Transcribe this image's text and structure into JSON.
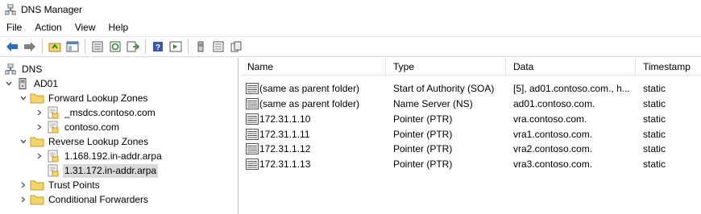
{
  "window": {
    "title": "DNS Manager",
    "icon": "dns-manager-icon"
  },
  "menu": [
    "File",
    "Action",
    "View",
    "Help"
  ],
  "toolbar": {
    "buttons": [
      "back-arrow-icon",
      "forward-arrow-icon",
      "up-folder-icon",
      "show-hide-console-tree-icon",
      "properties-icon",
      "refresh-icon",
      "export-list-icon",
      "help-icon",
      "show-hide-action-pane-icon",
      "server-icon",
      "list-view-icon",
      "copy-icon"
    ]
  },
  "tree": {
    "root": "DNS",
    "server": "AD01",
    "forward": "Forward Lookup Zones",
    "forward_children": [
      "_msdcs.contoso.com",
      "contoso.com"
    ],
    "reverse": "Reverse Lookup Zones",
    "reverse_children": [
      "1.168.192.in-addr.arpa",
      "1.31.172.in-addr.arpa"
    ],
    "trust": "Trust Points",
    "conditional": "Conditional Forwarders"
  },
  "table": {
    "columns": [
      "Name",
      "Type",
      "Data",
      "Timestamp"
    ],
    "rows": [
      {
        "name": "(same as parent folder)",
        "type": "Start of Authority (SOA)",
        "data": "[5], ad01.contoso.com., h...",
        "timestamp": "static"
      },
      {
        "name": "(same as parent folder)",
        "type": "Name Server (NS)",
        "data": "ad01.contoso.com.",
        "timestamp": "static"
      },
      {
        "name": "172.31.1.10",
        "type": "Pointer (PTR)",
        "data": "vra.contoso.com.",
        "timestamp": "static"
      },
      {
        "name": "172.31.1.11",
        "type": "Pointer (PTR)",
        "data": "vra1.contoso.com.",
        "timestamp": "static"
      },
      {
        "name": "172.31.1.12",
        "type": "Pointer (PTR)",
        "data": "vra2.contoso.com.",
        "timestamp": "static"
      },
      {
        "name": "172.31.1.13",
        "type": "Pointer (PTR)",
        "data": "vra3.contoso.com.",
        "timestamp": "static"
      }
    ]
  },
  "colors": {
    "folder": "#f5d36b",
    "selection": "#d9d9d9",
    "accent": "#2a6ebd"
  }
}
